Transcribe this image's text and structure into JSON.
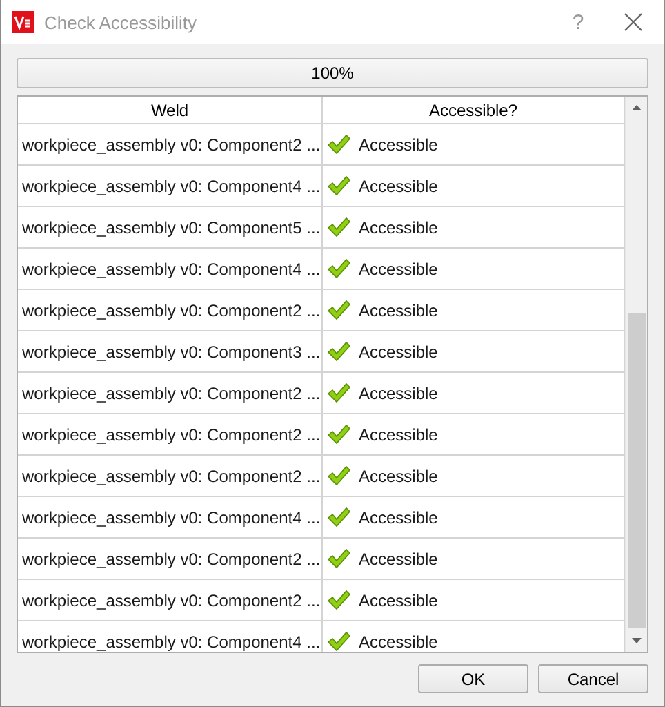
{
  "window": {
    "title": "Check Accessibility",
    "help_button": "?"
  },
  "progress": {
    "level": 1,
    "label": "100%"
  },
  "table": {
    "columns": [
      "Weld",
      "Accessible?"
    ],
    "rows": [
      {
        "weld": "workpiece_assembly v0: Component2 ...",
        "status": "Accessible",
        "accessible": true
      },
      {
        "weld": "workpiece_assembly v0: Component4 ...",
        "status": "Accessible",
        "accessible": true
      },
      {
        "weld": "workpiece_assembly v0: Component5 ...",
        "status": "Accessible",
        "accessible": true
      },
      {
        "weld": "workpiece_assembly v0: Component4 ...",
        "status": "Accessible",
        "accessible": true
      },
      {
        "weld": "workpiece_assembly v0: Component2 ...",
        "status": "Accessible",
        "accessible": true
      },
      {
        "weld": "workpiece_assembly v0: Component3 ...",
        "status": "Accessible",
        "accessible": true
      },
      {
        "weld": "workpiece_assembly v0: Component2 ...",
        "status": "Accessible",
        "accessible": true
      },
      {
        "weld": "workpiece_assembly v0: Component2 ...",
        "status": "Accessible",
        "accessible": true
      },
      {
        "weld": "workpiece_assembly v0: Component2 ...",
        "status": "Accessible",
        "accessible": true
      },
      {
        "weld": "workpiece_assembly v0: Component4 ...",
        "status": "Accessible",
        "accessible": true
      },
      {
        "weld": "workpiece_assembly v0: Component2 ...",
        "status": "Accessible",
        "accessible": true
      },
      {
        "weld": "workpiece_assembly v0: Component2 ...",
        "status": "Accessible",
        "accessible": true
      },
      {
        "weld": "workpiece_assembly v0: Component4 ...",
        "status": "Accessible",
        "accessible": true
      }
    ]
  },
  "buttons": [
    "OK",
    "Cancel"
  ]
}
